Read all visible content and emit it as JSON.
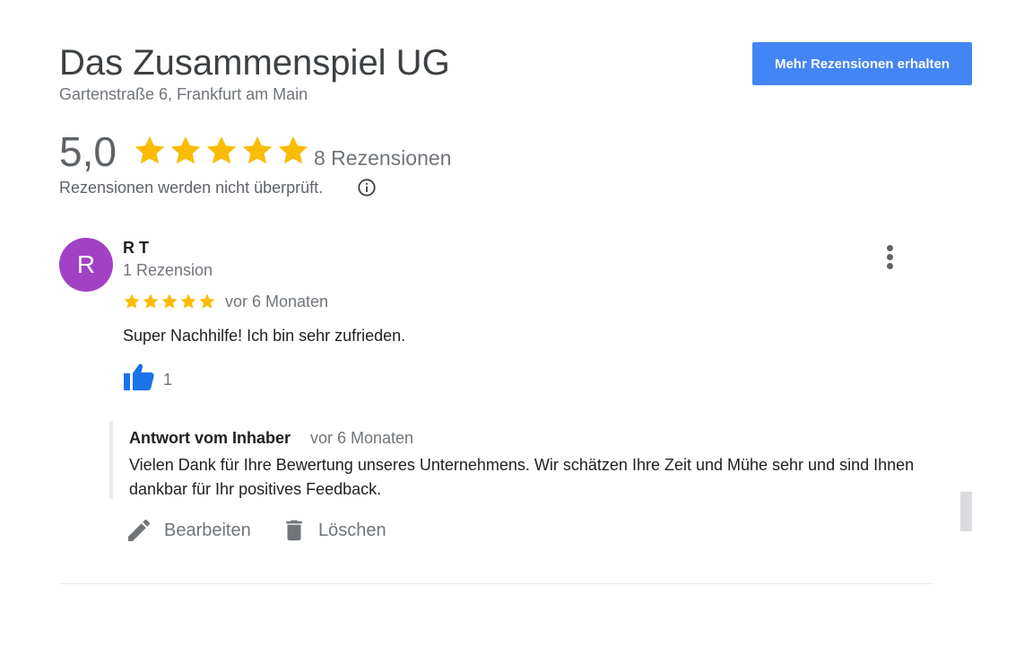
{
  "business": {
    "name": "Das Zusammenspiel UG",
    "address": "Gartenstraße 6, Frankfurt am Main",
    "cta_label": "Mehr Rezensionen erhalten"
  },
  "summary": {
    "rating": "5,0",
    "star_count": 5,
    "review_count": "8 Rezensionen",
    "unverified_note": "Rezensionen werden nicht überprüft.",
    "info_icon": "info-circle-icon"
  },
  "review": {
    "avatar_initial": "R",
    "avatar_color": "#a142c4",
    "author": "R T",
    "author_meta": "1 Rezension",
    "stars": 5,
    "time": "vor 6 Monaten",
    "text": "Super Nachhilfe! Ich bin sehr zufrieden.",
    "like_count": "1",
    "more_icon": "more-vertical-icon",
    "like_icon": "thumbs-up-icon"
  },
  "owner_reply": {
    "author": "Antwort vom Inhaber",
    "time": "vor 6 Monaten",
    "text": "Vielen Dank für Ihre Bewertung unseres Unternehmens. Wir schätzen Ihre Zeit und Mühe sehr und sind Ihnen dankbar für Ihr positives Feedback."
  },
  "actions": {
    "edit_label": "Bearbeiten",
    "edit_icon": "pencil-icon",
    "delete_label": "Löschen",
    "delete_icon": "trash-icon"
  },
  "colors": {
    "accent": "#4285f4",
    "star": "#fbbc04",
    "like": "#1a73e8",
    "text_primary": "#202124",
    "text_secondary": "#70757a"
  }
}
